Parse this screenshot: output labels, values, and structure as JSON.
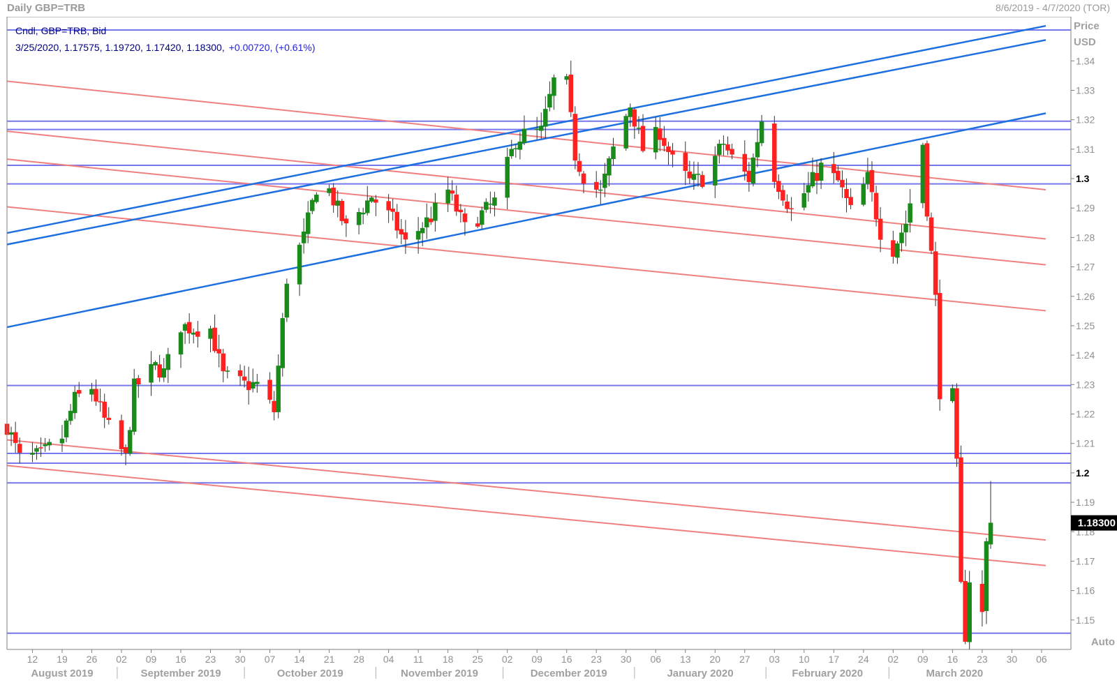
{
  "header": {
    "title": "Daily GBP=TRB",
    "date_range": "8/6/2019 - 4/7/2020 (TOR)"
  },
  "legend": {
    "line1": "Cndl, GBP=TRB, Bid",
    "ohlc": "3/25/2020, 1.17575, 1.19720, 1.17420, 1.18300,",
    "change": "+0.00720, (+0.61%)"
  },
  "axis": {
    "price_label": "Price",
    "currency_label": "USD",
    "auto_label": "Auto",
    "last_price": "1.18300"
  },
  "colors": {
    "up": "#1a8a1a",
    "down": "#ff2020",
    "support_resistance": "#7777ee",
    "up_trend": "#1e6fe0",
    "down_trend": "#f08080",
    "last_price_bg": "#000000"
  },
  "chart_data": {
    "type": "candlestick",
    "title": "Daily GBP=TRB",
    "ylim": [
      1.14,
      1.355
    ],
    "y_ticks": [
      1.15,
      1.16,
      1.17,
      1.18,
      1.19,
      1.2,
      1.21,
      1.22,
      1.23,
      1.24,
      1.25,
      1.26,
      1.27,
      1.28,
      1.29,
      1.3,
      1.31,
      1.32,
      1.33,
      1.34
    ],
    "y_tick_labels": [
      "1.15",
      "1.16",
      "1.17",
      "1.18",
      "1.19",
      "1.2",
      "1.21",
      "1.22",
      "1.23",
      "1.24",
      "1.25",
      "1.26",
      "1.27",
      "1.28",
      "1.29",
      "1.3",
      "1.31",
      "1.32",
      "1.33",
      "1.34"
    ],
    "y_bold_labels": [
      "1.2",
      "1.3"
    ],
    "x_start": "2019-08-06",
    "x_end": "2020-04-07",
    "x_ticks": [
      {
        "date": "2019-08-12",
        "label": "12"
      },
      {
        "date": "2019-08-19",
        "label": "19"
      },
      {
        "date": "2019-08-26",
        "label": "26"
      },
      {
        "date": "2019-09-02",
        "label": "02"
      },
      {
        "date": "2019-09-09",
        "label": "09"
      },
      {
        "date": "2019-09-16",
        "label": "16"
      },
      {
        "date": "2019-09-23",
        "label": "23"
      },
      {
        "date": "2019-09-30",
        "label": "30"
      },
      {
        "date": "2019-10-07",
        "label": "07"
      },
      {
        "date": "2019-10-14",
        "label": "14"
      },
      {
        "date": "2019-10-21",
        "label": "21"
      },
      {
        "date": "2019-10-28",
        "label": "28"
      },
      {
        "date": "2019-11-04",
        "label": "04"
      },
      {
        "date": "2019-11-11",
        "label": "11"
      },
      {
        "date": "2019-11-18",
        "label": "18"
      },
      {
        "date": "2019-11-25",
        "label": "25"
      },
      {
        "date": "2019-12-02",
        "label": "02"
      },
      {
        "date": "2019-12-09",
        "label": "09"
      },
      {
        "date": "2019-12-16",
        "label": "16"
      },
      {
        "date": "2019-12-23",
        "label": "23"
      },
      {
        "date": "2019-12-30",
        "label": "30"
      },
      {
        "date": "2020-01-06",
        "label": "06"
      },
      {
        "date": "2020-01-13",
        "label": "13"
      },
      {
        "date": "2020-01-20",
        "label": "20"
      },
      {
        "date": "2020-01-27",
        "label": "27"
      },
      {
        "date": "2020-02-03",
        "label": "03"
      },
      {
        "date": "2020-02-10",
        "label": "10"
      },
      {
        "date": "2020-02-17",
        "label": "17"
      },
      {
        "date": "2020-02-24",
        "label": "24"
      },
      {
        "date": "2020-03-02",
        "label": "02"
      },
      {
        "date": "2020-03-09",
        "label": "09"
      },
      {
        "date": "2020-03-16",
        "label": "16"
      },
      {
        "date": "2020-03-23",
        "label": "23"
      },
      {
        "date": "2020-03-30",
        "label": "30"
      },
      {
        "date": "2020-04-06",
        "label": "06"
      }
    ],
    "months": [
      {
        "label": "August 2019",
        "start": "2019-08-06",
        "end": "2019-09-01"
      },
      {
        "label": "September 2019",
        "start": "2019-09-01",
        "end": "2019-10-01"
      },
      {
        "label": "October 2019",
        "start": "2019-10-01",
        "end": "2019-11-01"
      },
      {
        "label": "November 2019",
        "start": "2019-11-01",
        "end": "2019-12-01"
      },
      {
        "label": "December 2019",
        "start": "2019-12-01",
        "end": "2020-01-01"
      },
      {
        "label": "January 2020",
        "start": "2020-01-01",
        "end": "2020-02-01"
      },
      {
        "label": "February 2020",
        "start": "2020-02-01",
        "end": "2020-03-01"
      },
      {
        "label": "March 2020",
        "start": "2020-03-01",
        "end": "2020-04-01"
      }
    ],
    "price_path": [
      [
        "2019-08-06",
        1.216
      ],
      [
        "2019-08-09",
        1.205
      ],
      [
        "2019-08-14",
        1.206
      ],
      [
        "2019-08-19",
        1.212
      ],
      [
        "2019-08-22",
        1.225
      ],
      [
        "2019-08-26",
        1.229
      ],
      [
        "2019-08-29",
        1.218
      ],
      [
        "2019-09-03",
        1.205
      ],
      [
        "2019-09-05",
        1.229
      ],
      [
        "2019-09-10",
        1.236
      ],
      [
        "2019-09-12",
        1.234
      ],
      [
        "2019-09-16",
        1.25
      ],
      [
        "2019-09-19",
        1.249
      ],
      [
        "2019-09-23",
        1.249
      ],
      [
        "2019-09-26",
        1.233
      ],
      [
        "2019-10-01",
        1.23
      ],
      [
        "2019-10-04",
        1.23
      ],
      [
        "2019-10-08",
        1.221
      ],
      [
        "2019-10-11",
        1.266
      ],
      [
        "2019-10-15",
        1.28
      ],
      [
        "2019-10-18",
        1.297
      ],
      [
        "2019-10-21",
        1.296
      ],
      [
        "2019-10-25",
        1.283
      ],
      [
        "2019-10-31",
        1.294
      ],
      [
        "2019-11-05",
        1.286
      ],
      [
        "2019-11-08",
        1.278
      ],
      [
        "2019-11-14",
        1.287
      ],
      [
        "2019-11-18",
        1.296
      ],
      [
        "2019-11-22",
        1.283
      ],
      [
        "2019-11-26",
        1.288
      ],
      [
        "2019-11-29",
        1.292
      ],
      [
        "2019-12-04",
        1.313
      ],
      [
        "2019-12-06",
        1.315
      ],
      [
        "2019-12-10",
        1.316
      ],
      [
        "2019-12-13",
        1.333
      ],
      [
        "2019-12-16",
        1.332
      ],
      [
        "2019-12-18",
        1.308
      ],
      [
        "2019-12-20",
        1.301
      ],
      [
        "2019-12-24",
        1.295
      ],
      [
        "2019-12-27",
        1.31
      ],
      [
        "2019-12-31",
        1.325
      ],
      [
        "2020-01-03",
        1.31
      ],
      [
        "2020-01-07",
        1.316
      ],
      [
        "2020-01-10",
        1.306
      ],
      [
        "2020-01-14",
        1.299
      ],
      [
        "2020-01-17",
        1.3
      ],
      [
        "2020-01-22",
        1.312
      ],
      [
        "2020-01-24",
        1.307
      ],
      [
        "2020-01-28",
        1.3
      ],
      [
        "2020-01-31",
        1.32
      ],
      [
        "2020-02-03",
        1.301
      ],
      [
        "2020-02-07",
        1.289
      ],
      [
        "2020-02-11",
        1.297
      ],
      [
        "2020-02-14",
        1.304
      ],
      [
        "2020-02-18",
        1.299
      ],
      [
        "2020-02-21",
        1.289
      ],
      [
        "2020-02-25",
        1.3
      ],
      [
        "2020-02-28",
        1.282
      ],
      [
        "2020-03-02",
        1.276
      ],
      [
        "2020-03-05",
        1.285
      ],
      [
        "2020-03-09",
        1.312
      ],
      [
        "2020-03-10",
        1.29
      ],
      [
        "2020-03-12",
        1.259
      ],
      [
        "2020-03-13",
        1.228
      ],
      [
        "2020-03-16",
        1.226
      ],
      [
        "2020-03-17",
        1.202
      ],
      [
        "2020-03-18",
        1.161
      ],
      [
        "2020-03-19",
        1.145
      ],
      [
        "2020-03-20",
        1.164
      ],
      [
        "2020-03-23",
        1.152
      ],
      [
        "2020-03-24",
        1.176
      ],
      [
        "2020-03-25",
        1.183
      ]
    ],
    "horizontal_levels": [
      1.3505,
      1.3195,
      1.3167,
      1.3045,
      1.2982,
      1.2297,
      1.2066,
      1.2033,
      1.1966,
      1.1455
    ],
    "up_trendlines": [
      {
        "from": [
          "2019-08-06",
          1.2815
        ],
        "to": [
          "2020-04-07",
          1.3519
        ]
      },
      {
        "from": [
          "2019-08-06",
          1.2776
        ],
        "to": [
          "2020-04-07",
          1.3471
        ]
      },
      {
        "from": [
          "2019-08-06",
          1.2495
        ],
        "to": [
          "2020-04-07",
          1.3222
        ]
      }
    ],
    "down_trendlines": [
      {
        "from": [
          "2019-08-06",
          1.3331
        ],
        "to": [
          "2020-04-07",
          1.2962
        ]
      },
      {
        "from": [
          "2019-08-06",
          1.3161
        ],
        "to": [
          "2020-04-07",
          1.2795
        ]
      },
      {
        "from": [
          "2019-08-06",
          1.3066
        ],
        "to": [
          "2020-04-07",
          1.2707
        ]
      },
      {
        "from": [
          "2019-08-06",
          1.2904
        ],
        "to": [
          "2020-04-07",
          1.2551
        ]
      },
      {
        "from": [
          "2019-08-06",
          1.2112
        ],
        "to": [
          "2020-04-07",
          1.1772
        ]
      },
      {
        "from": [
          "2019-08-06",
          1.2025
        ],
        "to": [
          "2020-04-07",
          1.1685
        ]
      }
    ],
    "last_candle": {
      "date": "2020-03-25",
      "open": 1.17575,
      "high": 1.1972,
      "low": 1.1742,
      "close": 1.183
    }
  }
}
